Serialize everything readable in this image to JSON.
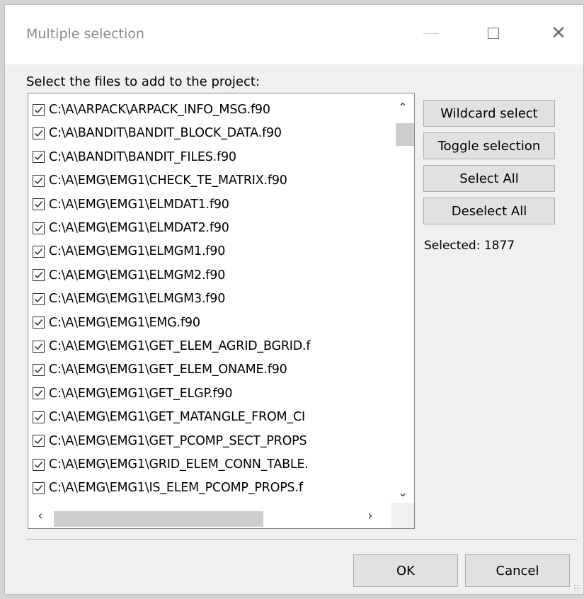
{
  "window": {
    "title": "Multiple selection",
    "minimize_icon": "minimize-icon",
    "maximize_icon": "maximize-icon",
    "close_icon": "close-icon"
  },
  "instruction": "Select the files to add to the project:",
  "files": [
    {
      "label": "C:\\A\\ARPACK\\ARPACK_INFO_MSG.f90",
      "checked": true
    },
    {
      "label": "C:\\A\\BANDIT\\BANDIT_BLOCK_DATA.f90",
      "checked": true
    },
    {
      "label": "C:\\A\\BANDIT\\BANDIT_FILES.f90",
      "checked": true
    },
    {
      "label": "C:\\A\\EMG\\EMG1\\CHECK_TE_MATRIX.f90",
      "checked": true
    },
    {
      "label": "C:\\A\\EMG\\EMG1\\ELMDAT1.f90",
      "checked": true
    },
    {
      "label": "C:\\A\\EMG\\EMG1\\ELMDAT2.f90",
      "checked": true
    },
    {
      "label": "C:\\A\\EMG\\EMG1\\ELMGM1.f90",
      "checked": true
    },
    {
      "label": "C:\\A\\EMG\\EMG1\\ELMGM2.f90",
      "checked": true
    },
    {
      "label": "C:\\A\\EMG\\EMG1\\ELMGM3.f90",
      "checked": true
    },
    {
      "label": "C:\\A\\EMG\\EMG1\\EMG.f90",
      "checked": true
    },
    {
      "label": "C:\\A\\EMG\\EMG1\\GET_ELEM_AGRID_BGRID.f",
      "checked": true
    },
    {
      "label": "C:\\A\\EMG\\EMG1\\GET_ELEM_ONAME.f90",
      "checked": true
    },
    {
      "label": "C:\\A\\EMG\\EMG1\\GET_ELGP.f90",
      "checked": true
    },
    {
      "label": "C:\\A\\EMG\\EMG1\\GET_MATANGLE_FROM_CI",
      "checked": true
    },
    {
      "label": "C:\\A\\EMG\\EMG1\\GET_PCOMP_SECT_PROPS",
      "checked": true
    },
    {
      "label": "C:\\A\\EMG\\EMG1\\GRID_ELEM_CONN_TABLE.",
      "checked": true
    },
    {
      "label": "C:\\A\\EMG\\EMG1\\IS_ELEM_PCOMP_PROPS.f",
      "checked": true
    }
  ],
  "scroll": {
    "up_icon": "scroll-up-icon",
    "down_icon": "scroll-down-icon",
    "left_icon": "scroll-left-icon",
    "right_icon": "scroll-right-icon"
  },
  "actions": {
    "wildcard": "Wildcard select",
    "toggle": "Toggle selection",
    "select_all": "Select All",
    "deselect_all": "Deselect All"
  },
  "selected_text": "Selected: 1877",
  "footer": {
    "ok": "OK",
    "cancel": "Cancel"
  }
}
